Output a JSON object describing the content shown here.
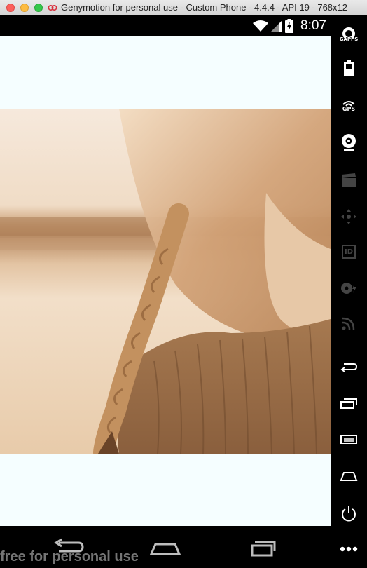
{
  "window": {
    "title": "Genymotion for personal use - Custom Phone - 4.4.4 - API 19 - 768x12"
  },
  "status_bar": {
    "time": "8:07",
    "icons": [
      "wifi-icon",
      "signal-icon",
      "battery-charging-icon"
    ]
  },
  "content": {
    "image": {
      "description_icon": "photo-sepia-braid"
    }
  },
  "navigation": {
    "buttons": [
      "back-icon",
      "home-icon",
      "recent-apps-icon"
    ]
  },
  "sidebar": {
    "gapps_label": "GAPPS",
    "gps_label": "GPS",
    "id_label": "ID",
    "items": [
      "gapps-icon",
      "battery-icon",
      "gps-icon",
      "camera-icon",
      "clapperboard-icon",
      "dpad-icon",
      "id-icon",
      "disk-icon",
      "rss-icon",
      "back-icon",
      "recent-apps-icon",
      "menu-icon",
      "home-icon",
      "power-icon",
      "more-icon"
    ]
  },
  "watermark": {
    "text": "free for personal use"
  },
  "colors": {
    "screen_background": "#f5feff",
    "bar_black": "#000000",
    "sidebar_active": "#ffffff",
    "sidebar_disabled": "#444444"
  }
}
